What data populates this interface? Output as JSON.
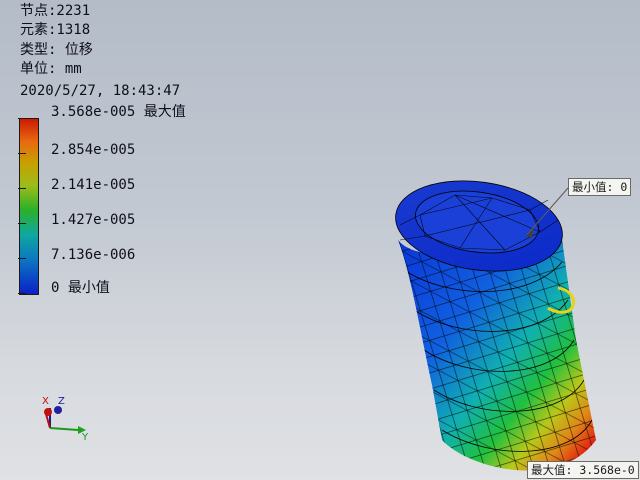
{
  "info": {
    "nodes": "节点:2231",
    "elements": "元素:1318",
    "type": "类型: 位移",
    "unit": "单位: mm",
    "timestamp": "2020/5/27, 18:43:47"
  },
  "legend": {
    "labels": [
      "3.568e-005 最大值",
      "2.854e-005",
      "2.141e-005",
      "1.427e-005",
      "7.136e-006",
      "0 最小值"
    ],
    "colors": [
      "#cc1a00",
      "#e86a10",
      "#c8a000",
      "#9cbc1a",
      "#2cb028",
      "#10a8a0",
      "#0c78c0",
      "#0a20c8"
    ]
  },
  "callouts": {
    "min": "最小值: 0",
    "max": "最大值: 3.568e-0"
  },
  "triad": {
    "x": "X",
    "y": "Y",
    "z": "Z"
  }
}
